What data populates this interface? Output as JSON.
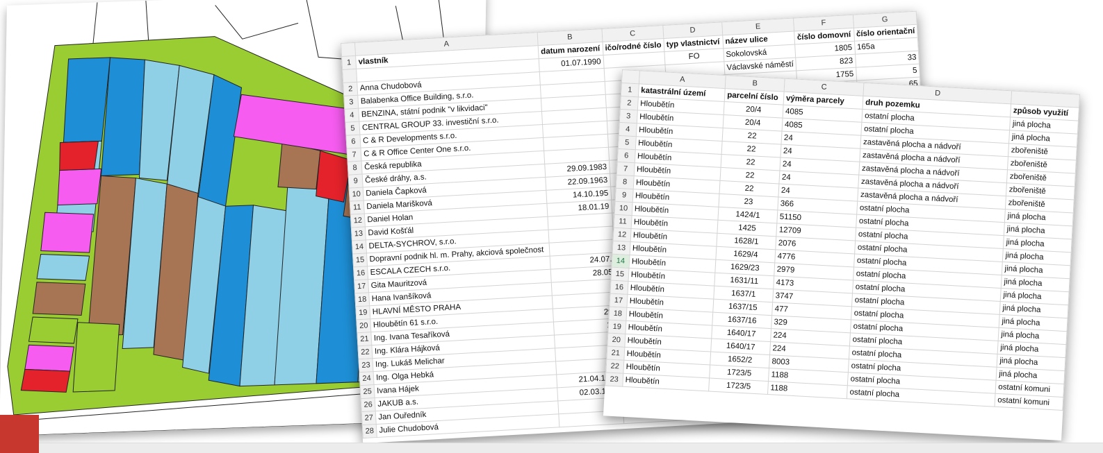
{
  "colors": {
    "accent_red": "#c8372d",
    "map_green": "#9acd32",
    "map_blue": "#1e8fd6",
    "map_light_blue": "#8fd0e6",
    "map_brown": "#a87554",
    "map_magenta": "#f65cf0",
    "map_red": "#e4222b"
  },
  "sheet1": {
    "columns": [
      "A",
      "B",
      "C",
      "D",
      "E",
      "F",
      "G"
    ],
    "header": [
      "vlastník",
      "datum narození",
      "ičo/rodné číslo",
      "typ vlastnictví",
      "název ulice",
      "číslo domovní",
      "číslo orientační"
    ],
    "top_row": {
      "a": "",
      "b": "01.07.1990",
      "c": "",
      "d": "FO",
      "e": "Sokolovská",
      "f": "1805",
      "g": "165a"
    },
    "rows": [
      {
        "n": "2",
        "a": "Anna Chudobová",
        "b": "",
        "e": "Václavské náměstí",
        "f": "823",
        "g": "33"
      },
      {
        "n": "3",
        "a": "Balabenka Office Building, s.r.o.",
        "b": "",
        "e": "",
        "f": "1755",
        "g": "5"
      },
      {
        "n": "4",
        "a": "BENZINA, státní podnik \"v likvidaci\"",
        "b": "",
        "e": "",
        "f": "1702",
        "g": "65"
      },
      {
        "n": "5",
        "a": "CENTRAL GROUP 33. investiční s.r.o.",
        "b": "",
        "e": "",
        "f": "",
        "g": "14"
      },
      {
        "n": "6",
        "a": "C & R Developments s.r.o.",
        "b": "",
        "e": "",
        "f": "",
        "g": ""
      },
      {
        "n": "7",
        "a": "C & R Office Center One s.r.o.",
        "b": "",
        "e": "",
        "f": "",
        "g": ""
      },
      {
        "n": "8",
        "a": "Česká republika",
        "b": "",
        "e": "",
        "f": "",
        "g": ""
      },
      {
        "n": "9",
        "a": "České dráhy, a.s.",
        "b": "29.09.1983",
        "e": "",
        "f": "",
        "g": ""
      },
      {
        "n": "10",
        "a": "Daniela Čapková",
        "b": "22.09.1963",
        "e": "",
        "f": "",
        "g": ""
      },
      {
        "n": "11",
        "a": "Daniela Marišková",
        "b": "14.10.195",
        "e": "",
        "f": "",
        "g": ""
      },
      {
        "n": "12",
        "a": "Daniel Holan",
        "b": "18.01.19",
        "e": "",
        "f": "",
        "g": ""
      },
      {
        "n": "13",
        "a": "David Košťál",
        "b": "",
        "e": "",
        "f": "",
        "g": ""
      },
      {
        "n": "14",
        "a": "DELTA-SYCHROV, s.r.o.",
        "b": "",
        "e": "",
        "f": "",
        "g": ""
      },
      {
        "n": "15",
        "a": "Dopravní podnik hl. m. Prahy, akciová společnost",
        "b": "",
        "e": "",
        "f": "",
        "g": ""
      },
      {
        "n": "16",
        "a": "ESCALA CZECH s.r.o.",
        "b": "24.07.",
        "e": "",
        "f": "",
        "g": ""
      },
      {
        "n": "17",
        "a": "Gita Mauritzová",
        "b": "28.05",
        "e": "",
        "f": "",
        "g": ""
      },
      {
        "n": "18",
        "a": "Hana Ivanšíková",
        "b": "",
        "e": "",
        "f": "",
        "g": ""
      },
      {
        "n": "19",
        "a": "HLAVNÍ MĚSTO PRAHA",
        "b": "",
        "e": "",
        "f": "",
        "g": ""
      },
      {
        "n": "20",
        "a": "Hloubětín 61 s.r.o.",
        "b": "29.",
        "e": "",
        "f": "",
        "g": ""
      },
      {
        "n": "21",
        "a": "Ing. Ivana Tesaříková",
        "b": "17",
        "e": "",
        "f": "",
        "g": ""
      },
      {
        "n": "22",
        "a": "Ing. Klára Hájková",
        "b": "1",
        "e": "",
        "f": "",
        "g": ""
      },
      {
        "n": "23",
        "a": "Ing. Lukáš Melichar",
        "b": "2",
        "e": "",
        "f": "",
        "g": ""
      },
      {
        "n": "24",
        "a": "Ing. Olga Hebká",
        "b": "",
        "e": "",
        "f": "",
        "g": ""
      },
      {
        "n": "25",
        "a": "Ivana Hájek",
        "b": "21.04.1965",
        "e": "",
        "f": "",
        "g": ""
      },
      {
        "n": "26",
        "a": "JAKUB a.s.",
        "b": "02.03.1992",
        "e": "FO",
        "f": "",
        "g": ""
      },
      {
        "n": "27",
        "a": "Jan Ouředník",
        "b": "",
        "e": "",
        "f": "",
        "g": ""
      },
      {
        "n": "28",
        "a": "Julie Chudobová",
        "b": "",
        "e": "",
        "f": "",
        "g": ""
      }
    ]
  },
  "sheet2": {
    "columns": [
      "A",
      "B",
      "C",
      "D",
      ""
    ],
    "header": [
      "katastrální území",
      "parcelní číslo",
      "výměra parcely",
      "druh pozemku",
      "způsob využití"
    ],
    "rows": [
      {
        "n": "2",
        "a": "Hloubětín",
        "b": "20/4",
        "c": "4085",
        "d": "ostatní plocha",
        "e": "jiná plocha"
      },
      {
        "n": "3",
        "a": "Hloubětín",
        "b": "20/4",
        "c": "4085",
        "d": "ostatní plocha",
        "e": "jiná plocha"
      },
      {
        "n": "4",
        "a": "Hloubětín",
        "b": "22",
        "c": "24",
        "d": "zastavěná plocha a nádvoří",
        "e": "zbořeniště"
      },
      {
        "n": "5",
        "a": "Hloubětín",
        "b": "22",
        "c": "24",
        "d": "zastavěná plocha a nádvoří",
        "e": "zbořeniště"
      },
      {
        "n": "6",
        "a": "Hloubětín",
        "b": "22",
        "c": "24",
        "d": "zastavěná plocha a nádvoří",
        "e": "zbořeniště"
      },
      {
        "n": "7",
        "a": "Hloubětín",
        "b": "22",
        "c": "24",
        "d": "zastavěná plocha a nádvoří",
        "e": "zbořeniště"
      },
      {
        "n": "8",
        "a": "Hloubětín",
        "b": "22",
        "c": "24",
        "d": "zastavěná plocha a nádvoří",
        "e": "zbořeniště"
      },
      {
        "n": "9",
        "a": "Hloubětín",
        "b": "23",
        "c": "366",
        "d": "ostatní plocha",
        "e": "jiná plocha"
      },
      {
        "n": "10",
        "a": "Hloubětín",
        "b": "1424/1",
        "c": "51150",
        "d": "ostatní plocha",
        "e": "jiná plocha"
      },
      {
        "n": "11",
        "a": "Hloubětín",
        "b": "1425",
        "c": "12709",
        "d": "ostatní plocha",
        "e": "jiná plocha"
      },
      {
        "n": "12",
        "a": "Hloubětín",
        "b": "1628/1",
        "c": "2076",
        "d": "ostatní plocha",
        "e": "jiná plocha"
      },
      {
        "n": "13",
        "a": "Hloubětín",
        "b": "1629/4",
        "c": "4776",
        "d": "ostatní plocha",
        "e": "jiná plocha"
      },
      {
        "n": "14",
        "a": "Hloubětín",
        "b": "1629/23",
        "c": "2979",
        "d": "ostatní plocha",
        "e": "jiná plocha"
      },
      {
        "n": "15",
        "a": "Hloubětín",
        "b": "1631/11",
        "c": "4173",
        "d": "ostatní plocha",
        "e": "jiná plocha"
      },
      {
        "n": "16",
        "a": "Hloubětín",
        "b": "1637/1",
        "c": "3747",
        "d": "ostatní plocha",
        "e": "jiná plocha"
      },
      {
        "n": "17",
        "a": "Hloubětín",
        "b": "1637/15",
        "c": "477",
        "d": "ostatní plocha",
        "e": "jiná plocha"
      },
      {
        "n": "18",
        "a": "Hloubětín",
        "b": "1637/16",
        "c": "329",
        "d": "ostatní plocha",
        "e": "jiná plocha"
      },
      {
        "n": "19",
        "a": "Hloubětín",
        "b": "1640/17",
        "c": "224",
        "d": "ostatní plocha",
        "e": "jiná plocha"
      },
      {
        "n": "20",
        "a": "Hloubětín",
        "b": "1640/17",
        "c": "224",
        "d": "ostatní plocha",
        "e": "jiná plocha"
      },
      {
        "n": "21",
        "a": "Hloubětín",
        "b": "1652/2",
        "c": "8003",
        "d": "ostatní plocha",
        "e": "jiná plocha"
      },
      {
        "n": "22",
        "a": "Hloubětín",
        "b": "1723/5",
        "c": "1188",
        "d": "ostatní plocha",
        "e": "ostatní komuni"
      },
      {
        "n": "23",
        "a": "Hloubětín",
        "b": "1723/5",
        "c": "1188",
        "d": "ostatní plocha",
        "e": "ostatní komuni"
      }
    ]
  }
}
